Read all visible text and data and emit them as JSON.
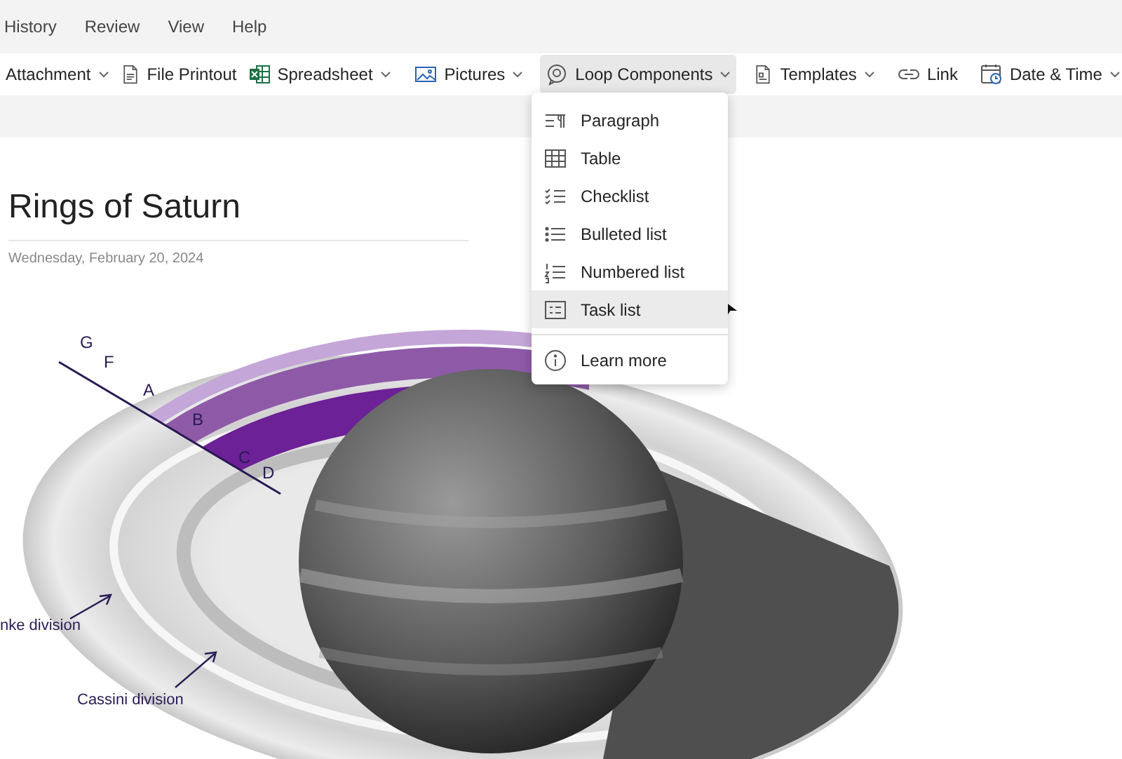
{
  "menu_bar": [
    {
      "label": "History"
    },
    {
      "label": "Review"
    },
    {
      "label": "View"
    },
    {
      "label": "Help"
    }
  ],
  "toolbar": [
    [
      {
        "label": "Attachment",
        "has_menu": true
      },
      {
        "label": "File Printout",
        "has_menu": false
      },
      {
        "label": "Spreadsheet",
        "has_menu": true
      }
    ],
    [
      {
        "label": "Pictures",
        "has_menu": true
      }
    ],
    [
      {
        "label": "Loop Components",
        "has_menu": true,
        "expanded": true
      }
    ],
    [
      {
        "label": "Templates",
        "has_menu": true
      }
    ],
    [
      {
        "label": "Link",
        "has_menu": false
      }
    ],
    [
      {
        "label": "Date & Time",
        "has_menu": true
      }
    ]
  ],
  "dropdown": {
    "items": [
      {
        "label": "Paragraph",
        "selected": false
      },
      {
        "label": "Table",
        "selected": false
      },
      {
        "label": "Checklist",
        "selected": false
      },
      {
        "label": "Bulleted list",
        "selected": false
      },
      {
        "label": "Numbered list",
        "selected": false
      },
      {
        "label": "Task list",
        "selected": true
      }
    ],
    "footer": {
      "label": "Learn more"
    }
  },
  "page": {
    "title": "Rings of Saturn",
    "date": "Wednesday, February 20, 2024",
    "figure_labels": [
      "G",
      "F",
      "A",
      "B",
      "C",
      "D"
    ],
    "annotations": [
      "nke division",
      "Cassini division"
    ]
  }
}
